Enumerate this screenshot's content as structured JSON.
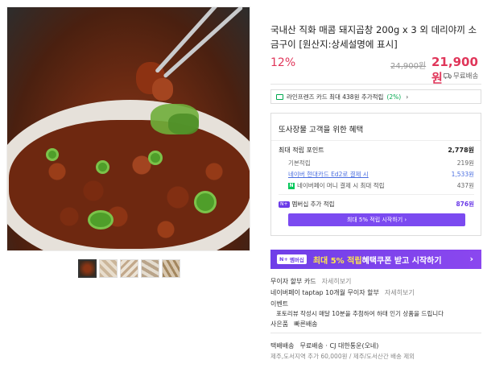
{
  "product": {
    "title": "국내산 직화 매콤 돼지곱창 200g x 3 외 데리야끼 소금구이 [원산지:상세설명에 표시]",
    "discount": "12%",
    "original_price": "24,900원",
    "price": "21,900원",
    "shipping_label": "무료배송"
  },
  "card_promo": {
    "text": "라인프렌즈 카드 최대 438원 추가적립",
    "percent": "(2%)"
  },
  "benefits": {
    "heading": "또사장물 고객을 위한 혜택",
    "max_points_label": "최대 적립 포인트",
    "max_points_value": "2,778원",
    "rows": [
      {
        "label": "기본적립",
        "value": "219원"
      },
      {
        "label": "네이버 현대카드 Ed2로 결제 시",
        "value": "1,533원"
      },
      {
        "label": "네이버페이 머니 결제 시 최대 적립",
        "value": "437원"
      }
    ],
    "membership_label": "멤버십 추가 적립",
    "membership_value": "876원",
    "membership_button": "최대 5% 적립 시작하기"
  },
  "promo_banner": {
    "badge": "멤버십",
    "highlight": "최대 5% 적립",
    "text": " 혜택쿠폰 받고 시작하기"
  },
  "info": {
    "card_label": "무이자 할부 카드",
    "card_more": "자세히보기",
    "npay_label": "네이버페이 taptap 10개월 무이자 할부",
    "npay_more": "자세히보기",
    "event_label": "이벤트",
    "event_text": "포토리뷰 작성시 매달 10분을 추첨하여 하태 인기 상품을 드립니다",
    "gift_label": "사은품",
    "gift_value": "빠른배송",
    "shipping_label": "택배배송",
    "shipping_value": "무료배송 · CJ 대한통운(오네)",
    "shipping_sub": "제주,도서지역 추가 60,000원 / 제주/도서산간 배송 제외"
  },
  "colors": {
    "accent": "#e0365a",
    "membership": "#7b4af0",
    "naver_green": "#03c75a"
  },
  "icons": [
    "truck-icon",
    "card-icon",
    "npay-icon",
    "chevron-right-icon"
  ]
}
